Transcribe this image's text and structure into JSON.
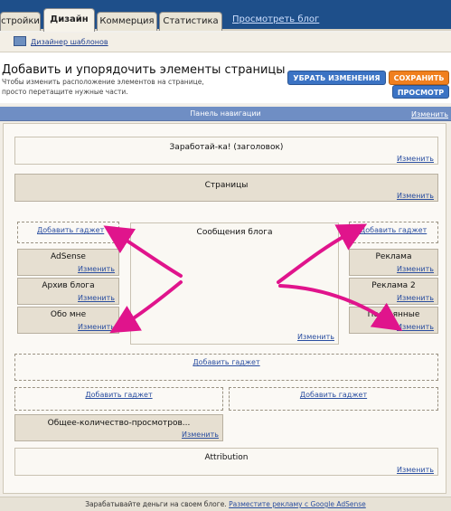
{
  "tabs": {
    "settings": "стройки",
    "design": "Дизайн",
    "commerce": "Коммерция",
    "stats": "Статистика",
    "view_blog": "Просмотреть блог"
  },
  "subnav": {
    "templates": "Дизайнер шаблонов"
  },
  "header": {
    "title": "Добавить и упорядочить элементы страницы",
    "desc": "Чтобы изменить расположение элементов на странице, просто перетащите нужные части.",
    "clear": "УБРАТЬ ИЗМЕНЕНИЯ",
    "save": "СОХРАНИТЬ",
    "preview": "ПРОСМОТР"
  },
  "colors": {
    "primary": "#3b73c4",
    "save": "#f07f1e",
    "accent": "#e0148c"
  },
  "nav": {
    "title": "Панель навигации",
    "edit": "Изменить"
  },
  "layout": {
    "title_block": {
      "label": "Заработай-ка! (заголовок)",
      "edit": "Изменить"
    },
    "pages_block": {
      "label": "Страницы",
      "edit": "Изменить"
    },
    "left_add": "Добавить гаджет",
    "left": [
      {
        "label": "AdSense",
        "edit": "Изменить"
      },
      {
        "label": "Архив блога",
        "edit": "Изменить"
      },
      {
        "label": "Обо мне",
        "edit": "Изменить"
      }
    ],
    "main": {
      "label": "Сообщения блога",
      "edit": "Изменить"
    },
    "right_add": "Добавить гаджет",
    "right": [
      {
        "label": "Реклама",
        "edit": "Изменить"
      },
      {
        "label": "Реклама 2",
        "edit": "Изменить"
      },
      {
        "label": "Постоянные",
        "edit": "Изменить"
      }
    ],
    "add_full": "Добавить гаджет",
    "add_col1": "Добавить гаджет",
    "add_col2": "Добавить гаджет",
    "views": {
      "label": "Общее-количество-просмотров...",
      "edit": "Изменить"
    },
    "attribution": {
      "label": "Attribution",
      "edit": "Изменить"
    }
  },
  "footer": {
    "text": "Зарабатывайте деньги на своем блоге.",
    "link": "Разместите рекламу с Google AdSense"
  }
}
